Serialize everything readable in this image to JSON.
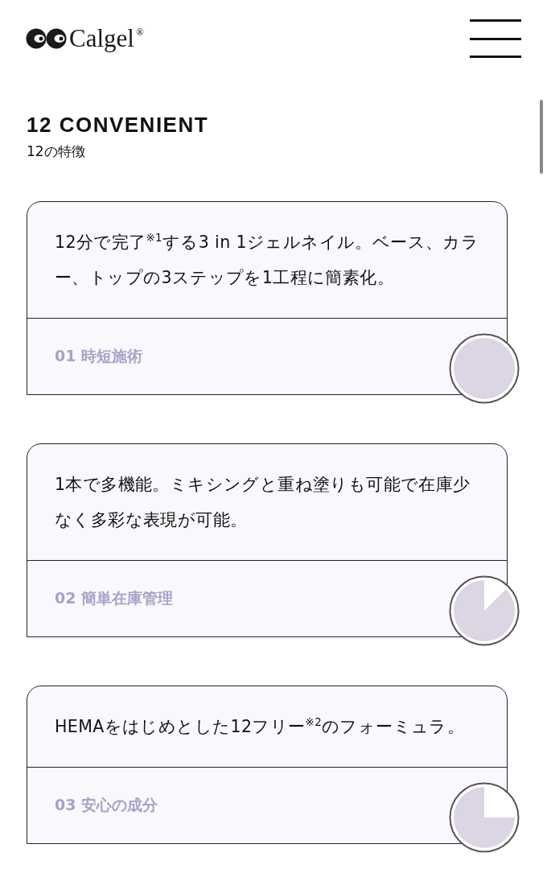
{
  "header": {
    "logo": {
      "name": "Calgel",
      "mark": "®"
    }
  },
  "section": {
    "title": "12 CONVENIENT",
    "subtitle": "12の特徴"
  },
  "cards": [
    {
      "description": "12分で完了$^{※1}$する3 in 1ジェルネイル。ベース、カラー、トップの3ステップを1工程に簡素化。",
      "label": "01 時短施術"
    },
    {
      "description": "1本で多機能。ミキシングと重ね塗りも可能で在庫少なく多彩な表現が可能。",
      "label": "02 簡単在庫管理"
    },
    {
      "description": "HEMAをはじめとした12フリー$^{※2}$のフォーミュラ。",
      "label": "03 安心の成分"
    }
  ]
}
